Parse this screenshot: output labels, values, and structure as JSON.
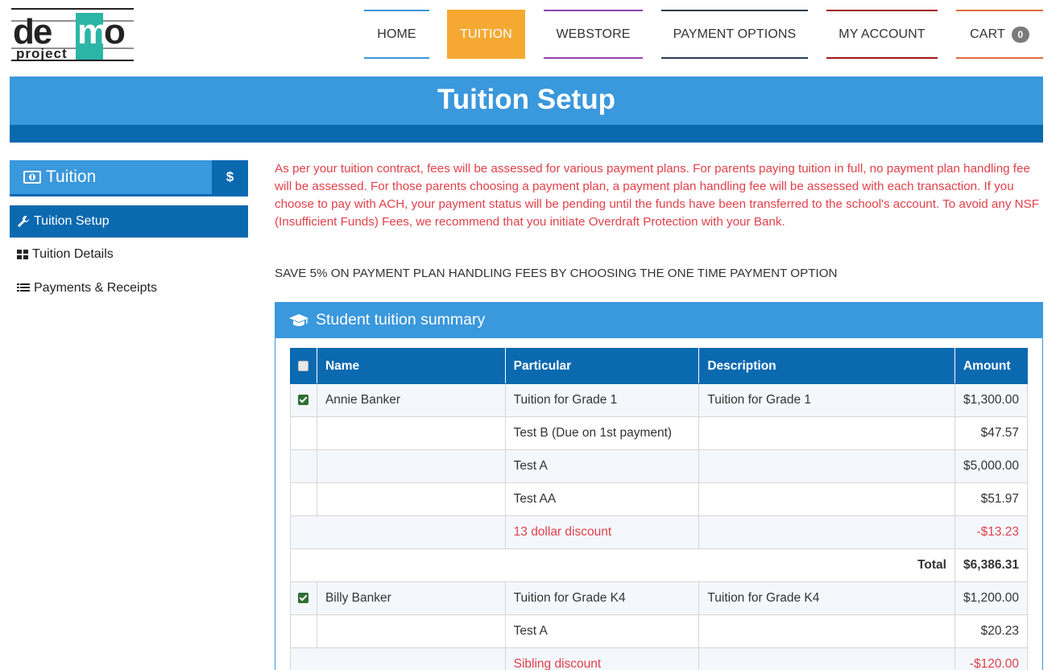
{
  "logo": {
    "line1": "demo",
    "line2": "project"
  },
  "nav": [
    {
      "label": "HOME",
      "color": "#3a98dc"
    },
    {
      "label": "TUITION",
      "color": "#f5a933",
      "active": true
    },
    {
      "label": "WEBSTORE",
      "color": "#8e44ad"
    },
    {
      "label": "PAYMENT OPTIONS",
      "color": "#2c3e50"
    },
    {
      "label": "MY ACCOUNT",
      "color": "#a01818"
    },
    {
      "label": "CART",
      "color": "#e06a3d",
      "badge": "0"
    }
  ],
  "page_title": "Tuition Setup",
  "sidebar": {
    "title": "Tuition",
    "title_icon": "money-icon",
    "action_label": "$",
    "items": [
      {
        "label": "Tuition Setup",
        "icon": "wrench-icon",
        "active": true
      },
      {
        "label": "Tuition Details",
        "icon": "grid-icon"
      },
      {
        "label": "Payments & Receipts",
        "icon": "list-icon"
      }
    ]
  },
  "notice": "As per your tuition contract, fees will be assessed for various payment plans.  For parents paying tuition in full, no payment plan handling fee will be assessed.  For those parents choosing a payment plan, a payment plan handling fee will be assessed with each transaction.  If you choose to pay with ACH, your payment status will be pending until the funds have been transferred to the school's account.  To avoid any NSF (Insufficient Funds) Fees, we recommend that you initiate Overdraft Protection with your Bank.",
  "save_message": "SAVE 5% ON PAYMENT PLAN HANDLING FEES BY CHOOSING THE ONE TIME PAYMENT OPTION",
  "summary": {
    "title": "Student tuition summary",
    "title_icon": "graduation-cap-icon",
    "columns": [
      "Name",
      "Particular",
      "Description",
      "Amount"
    ],
    "row1": {
      "name": "Annie Banker",
      "particular": "Tuition for Grade 1",
      "description": "Tuition for Grade 1",
      "amount": "$1,300.00"
    },
    "row2": {
      "particular": "Test B (Due on 1st payment)",
      "amount": "$47.57"
    },
    "row3": {
      "particular": "Test A",
      "amount": "$5,000.00"
    },
    "row4": {
      "particular": "Test AA",
      "amount": "$51.97"
    },
    "row5": {
      "particular": "13 dollar discount",
      "amount": "-$13.23"
    },
    "total1": {
      "label": "Total",
      "amount": "$6,386.31"
    },
    "row6": {
      "name": "Billy Banker",
      "particular": "Tuition for Grade K4",
      "description": "Tuition for Grade K4",
      "amount": "$1,200.00"
    },
    "row7": {
      "particular": "Test A",
      "amount": "$20.23"
    },
    "row8": {
      "particular": "Sibling discount",
      "amount": "-$120.00"
    }
  }
}
